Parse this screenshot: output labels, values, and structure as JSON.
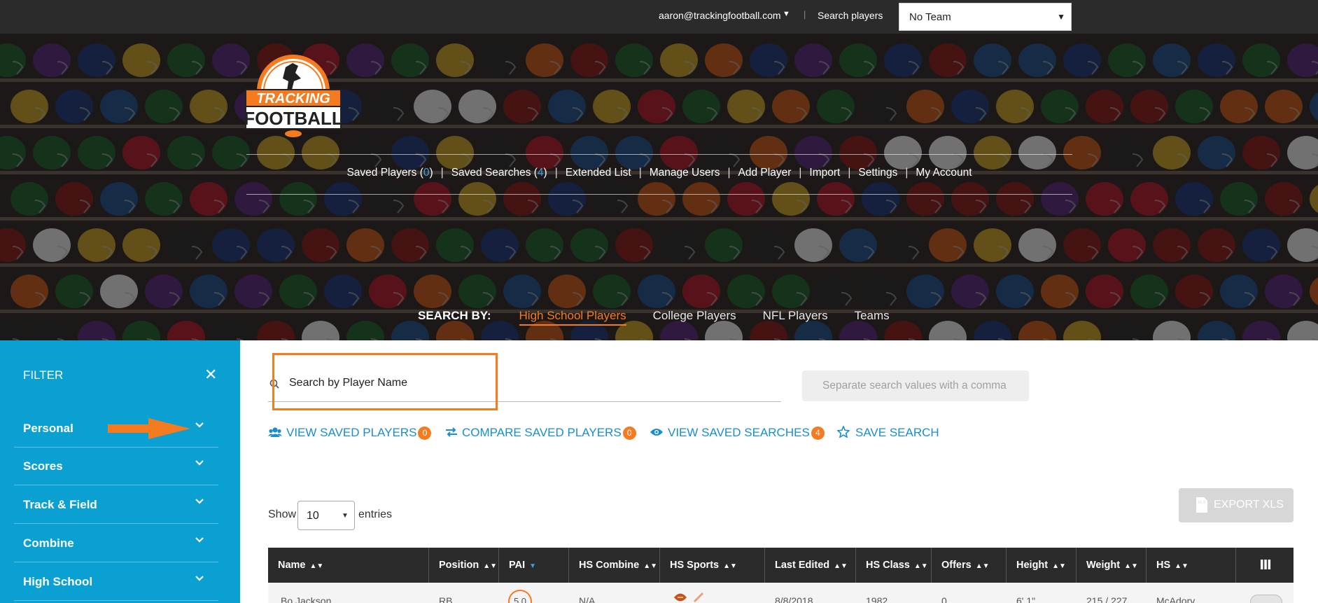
{
  "topbar": {
    "email": "aaron@trackingfootball.com",
    "search_players": "Search players",
    "team_select": "No Team"
  },
  "logo": {
    "line1": "TRACKING",
    "line2": "FOOTBALL"
  },
  "nav": {
    "saved_players": "Saved Players (",
    "saved_players_count": "0",
    "saved_searches": "Saved Searches (",
    "saved_searches_count": "4",
    "close_paren": ")",
    "extended_list": "Extended List",
    "manage_users": "Manage Users",
    "add_player": "Add Player",
    "import": "Import",
    "settings": "Settings",
    "my_account": "My Account"
  },
  "search_by": {
    "label": "SEARCH BY:",
    "tabs": [
      "High School Players",
      "College Players",
      "NFL Players",
      "Teams"
    ],
    "active": "High School Players"
  },
  "sidebar": {
    "title": "FILTER",
    "groups": [
      "Personal",
      "Scores",
      "Track & Field",
      "Combine",
      "High School"
    ]
  },
  "search": {
    "placeholder": "Search by Player Name",
    "multi_placeholder": "Separate search values with a comma"
  },
  "actions": {
    "view_saved_players": "VIEW SAVED PLAYERS",
    "view_saved_players_count": "0",
    "compare_saved_players": "COMPARE SAVED PLAYERS",
    "compare_saved_players_count": "0",
    "view_saved_searches": "VIEW SAVED SEARCHES",
    "view_saved_searches_count": "4",
    "save_search": "SAVE SEARCH"
  },
  "table_controls": {
    "show": "Show",
    "entries_value": "10",
    "entries": "entries",
    "export": "EXPORT XLS"
  },
  "table": {
    "columns": [
      "Name",
      "Position",
      "PAI",
      "HS Combine",
      "HS Sports",
      "Last Edited",
      "HS Class",
      "Offers",
      "Height",
      "Weight",
      "HS"
    ],
    "rows": [
      {
        "name": "Bo Jackson",
        "position": "RB",
        "pai": "5.0",
        "hs_combine": "N/A",
        "last_edited": "8/8/2018",
        "hs_class": "1982",
        "offers": "0",
        "height": "6' 1\"",
        "weight": "215 / 227",
        "hs": "McAdory"
      }
    ]
  },
  "colors": {
    "accent_orange": "#f47b20",
    "sidebar_blue": "#0aa0d2",
    "link_blue": "#1a8ecb",
    "dark": "#2b2b2b"
  }
}
